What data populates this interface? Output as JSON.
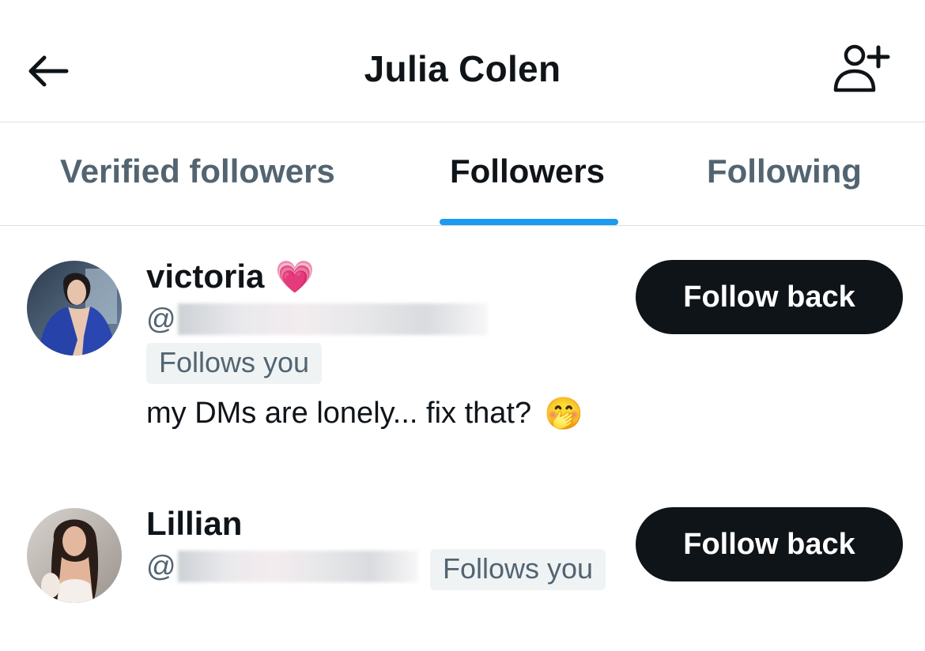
{
  "header": {
    "title": "Julia Colen",
    "back_icon": "arrow-left-icon",
    "add_icon": "add-user-icon"
  },
  "tabs": [
    {
      "label": "Verified followers",
      "active": false
    },
    {
      "label": "Followers",
      "active": true
    },
    {
      "label": "Following",
      "active": false
    }
  ],
  "accent_color": "#1d9bf0",
  "users": [
    {
      "name": "victoria",
      "name_emoji": "💗",
      "handle_prefix": "@",
      "badge": "Follows you",
      "bio": "my DMs are lonely... fix that?",
      "bio_emoji": "🤭",
      "button_label": "Follow back"
    },
    {
      "name": "Lillian",
      "handle_prefix": "@",
      "badge": "Follows you",
      "button_label": "Follow back"
    }
  ]
}
